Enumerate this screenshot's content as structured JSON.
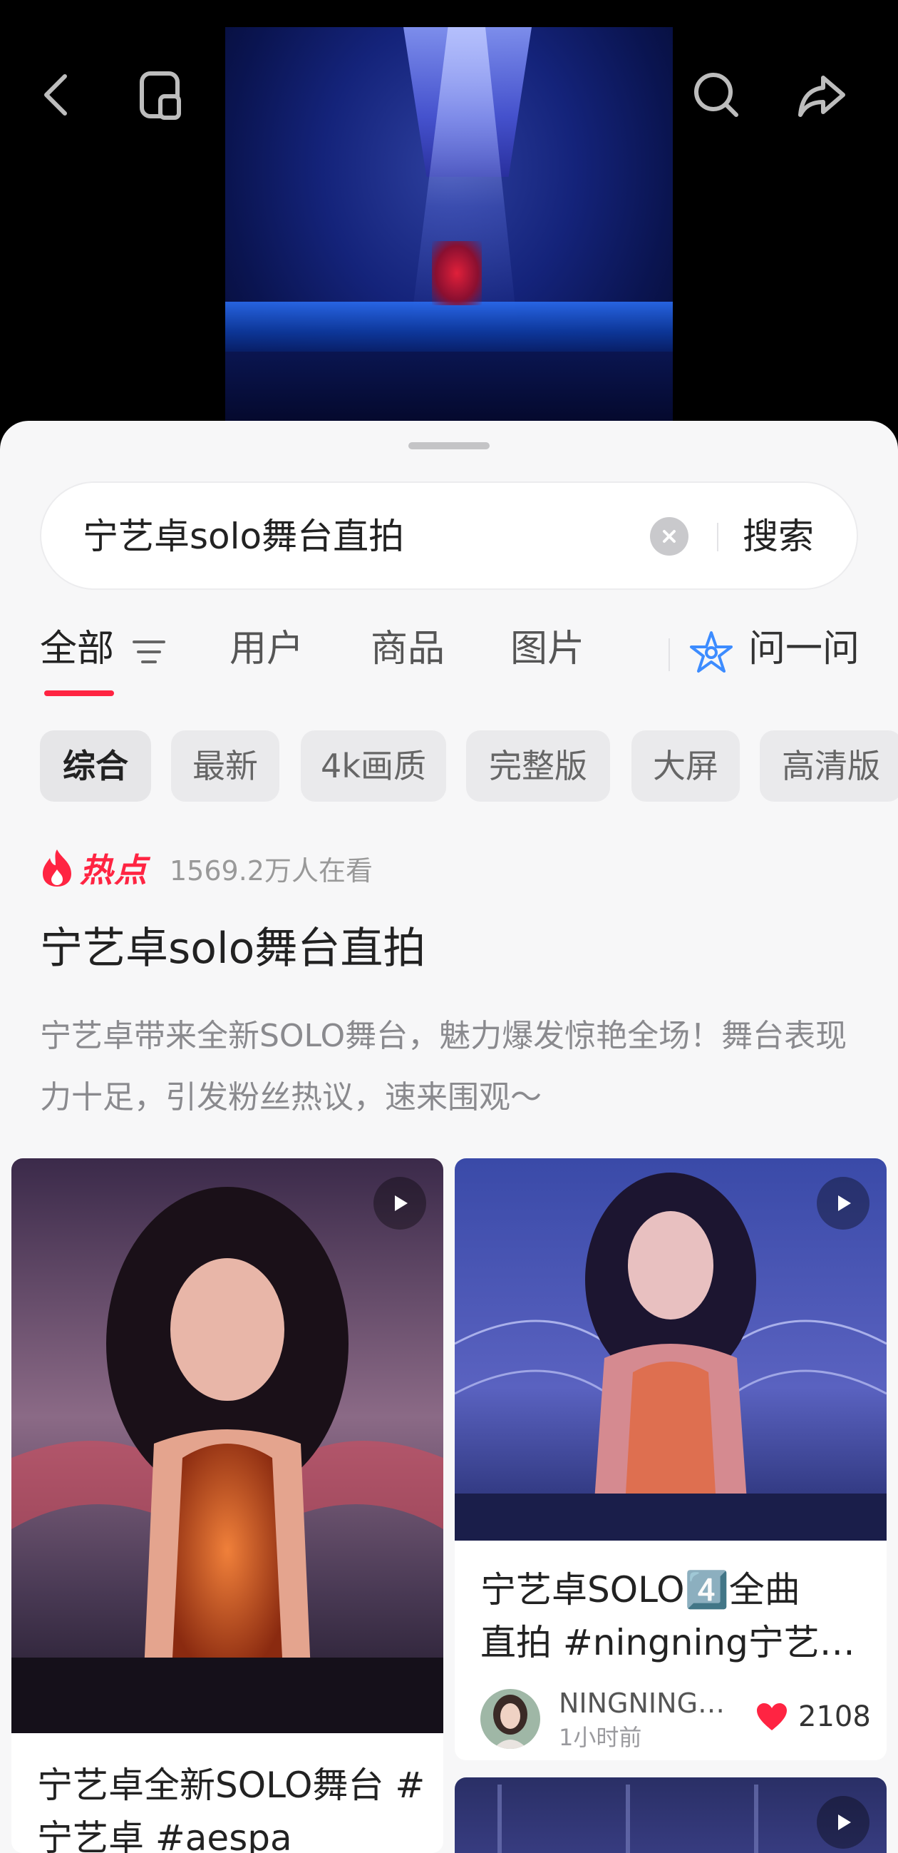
{
  "search": {
    "query": "宁艺卓solo舞台直拍",
    "button_label": "搜索"
  },
  "tabs": [
    {
      "label": "全部",
      "active": true
    },
    {
      "label": "用户"
    },
    {
      "label": "商品"
    },
    {
      "label": "图片"
    }
  ],
  "ask": {
    "label": "问一问"
  },
  "chips": [
    {
      "label": "综合",
      "active": true
    },
    {
      "label": "最新"
    },
    {
      "label": "4k画质"
    },
    {
      "label": "完整版"
    },
    {
      "label": "大屏"
    },
    {
      "label": "高清版"
    }
  ],
  "hot": {
    "label": "热点",
    "viewers": "1569.2万人在看",
    "title": "宁艺卓solo舞台直拍",
    "description": "宁艺卓带来全新SOLO舞台，魅力爆发惊艳全场！舞台表现力十足，引发粉丝热议，速来围观～"
  },
  "cards": [
    {
      "title_line1": "宁艺卓全新SOLO舞台 #",
      "title_line2": "宁艺卓  #aespa"
    },
    {
      "title_line1": "宁艺卓SOLO4️⃣全曲",
      "title_line2": "直拍 #ningning宁艺…",
      "author": "NINGNING…",
      "time": "1小时前",
      "likes": "2108"
    },
    {}
  ],
  "colors": {
    "accent": "#ff2442",
    "sheet_bg": "#f7f7f8"
  },
  "icons": {
    "back": "chevron-left-icon",
    "float_window": "pip-window-icon",
    "search": "search-icon",
    "share": "share-arrow-icon",
    "filter": "filter-icon",
    "ask": "sparkle-star-icon",
    "hot": "flame-icon",
    "play": "play-icon",
    "like": "heart-icon"
  }
}
